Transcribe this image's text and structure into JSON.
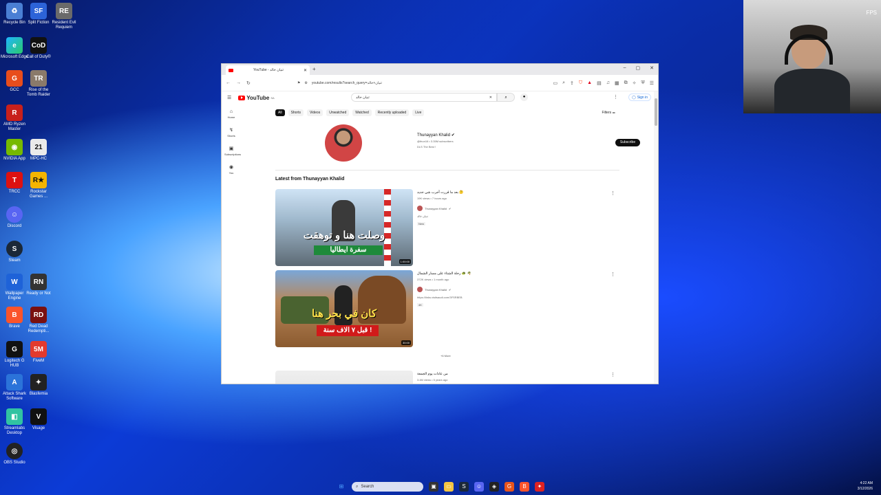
{
  "desktop": {
    "icons": [
      {
        "label": "Recycle Bin"
      },
      {
        "label": "Split Fiction"
      },
      {
        "label": "Resident Evil Requiem"
      },
      {
        "label": "Microsoft Edge"
      },
      {
        "label": "Call of Duty®"
      },
      {
        "label": "GCC"
      },
      {
        "label": "Rise of the Tomb Raider"
      },
      {
        "label": "AMD Ryzen Master"
      },
      {
        "label": "NVIDIA App"
      },
      {
        "label": "MPC-HC"
      },
      {
        "label": "TRCC"
      },
      {
        "label": "Rockstar Games ..."
      },
      {
        "label": "Discord"
      },
      {
        "label": "Steam"
      },
      {
        "label": "Wallpaper Engine"
      },
      {
        "label": "Ready or Not"
      },
      {
        "label": "Brave"
      },
      {
        "label": "Red Dead Redempti..."
      },
      {
        "label": "Logitech G HUB"
      },
      {
        "label": "FiveM"
      },
      {
        "label": "Attack Shark Software"
      },
      {
        "label": "Blasfemia"
      },
      {
        "label": "Streamlabs Desktop"
      },
      {
        "label": "Visage"
      },
      {
        "label": "OBS Studio"
      }
    ]
  },
  "webcam": {
    "fps": "FPS"
  },
  "browser": {
    "tab_title": "YouTube - ثنيان خالد",
    "new_tab": "+",
    "controls": {
      "min": "–",
      "max": "▢",
      "close": "✕"
    },
    "address": "youtube.com/results?search_query=ثنيان+خالد"
  },
  "youtube": {
    "logo": "YouTube",
    "logo_region": "SA",
    "search_value": "ثنيان خالد",
    "signin": "Sign in",
    "guide": [
      {
        "label": "Home"
      },
      {
        "label": "Shorts"
      },
      {
        "label": "Subscriptions"
      },
      {
        "label": "You"
      }
    ],
    "chips": [
      "All",
      "Shorts",
      "Videos",
      "Unwatched",
      "Watched",
      "Recently uploaded",
      "Live"
    ],
    "filters": "Filters",
    "channel": {
      "name": "Thunayyan Khalid",
      "meta": "@thun16 • 3.35M subscribers",
      "slogan": "DLS The Best !",
      "subscribe": "Subscribe"
    },
    "section_title": "Latest from Thunayyan Khalid",
    "videos": [
      {
        "title": "بعد ما قررت أجرب شي جديد 🤔",
        "meta": "19K views • 7 hours ago",
        "channel": "Thunayyan Khalid",
        "desc": "ثنيان خالد",
        "badge": "New",
        "duration": "1:00:00",
        "overlay_main": "وصلت هنا و توهقت",
        "overlay_sub": "سفرة ايطاليا"
      },
      {
        "title": "رحلة الشتاء على مسار الشمال 🐢 🌴",
        "meta": "372K views • 1 month ago",
        "channel": "Thunayyan Khalid",
        "desc": "https://links.visitsaudi.com/3FSRBEB",
        "badge": "4K",
        "duration": "30:00",
        "overlay_main": "كان في بحر هنا",
        "overlay_sub": "قبل ٧ الاف سنة !"
      },
      {
        "title": "من عادات يوم الجمعة",
        "meta": "3.4M views • 5 years ago",
        "channel": "",
        "desc": "",
        "badge": "",
        "duration": "",
        "overlay_main": "",
        "overlay_sub": ""
      }
    ],
    "more": "+6 More"
  },
  "taskbar": {
    "search": "Search",
    "time": "4:22 AM",
    "date": "3/12/2026"
  }
}
